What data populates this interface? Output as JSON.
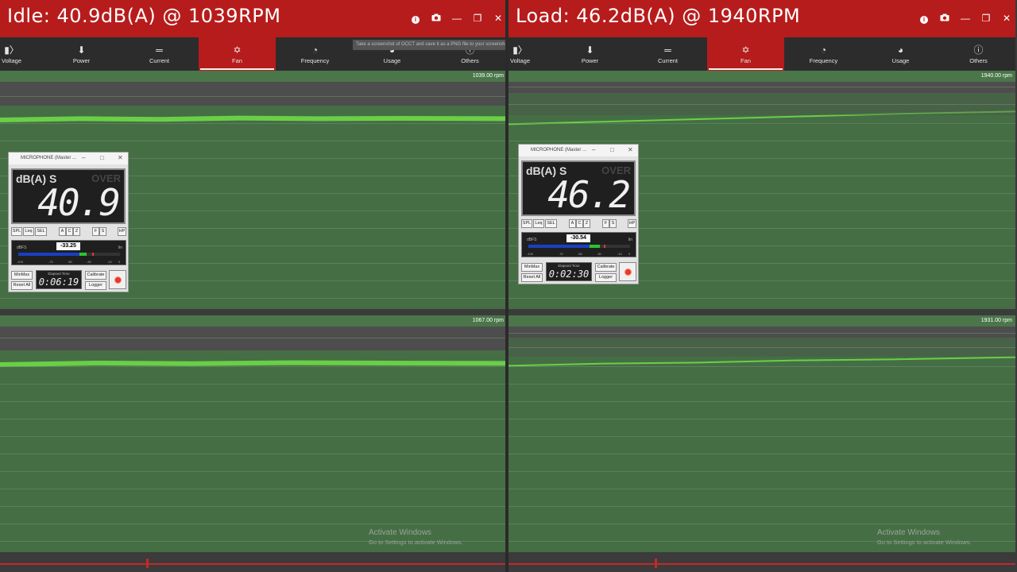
{
  "left": {
    "title": "Idle: 40.9dB(A) @ 1039RPM",
    "tabs": [
      "Voltage",
      "Power",
      "Current",
      "Fan",
      "Frequency",
      "Usage",
      "Others"
    ],
    "active_tab": "Fan",
    "tooltip": "Take a screenshot of OCCT and save it as a PNG file to your screenshot location",
    "panel_top_rpm": "1039.00 rpm",
    "panel_bottom_rpm": "1067.00 rpm",
    "meter": {
      "title": "MICROPHONE (Master ...",
      "unit": "dB(A) S",
      "over": "OVER",
      "reading": "40.9",
      "buttons": [
        "SPL",
        "Leq",
        "SEL",
        "A",
        "C",
        "Z",
        "F",
        "S",
        "HP"
      ],
      "dbfs_label": "dBFS",
      "lin_label": "lin",
      "dbfs_value": "-33.25",
      "scale": [
        "-100",
        "-70",
        "-50",
        "-30",
        "-10",
        "0"
      ],
      "minmax": "MinMax",
      "reset": "Reset All",
      "elapsed_label": "Elapsed Time",
      "elapsed": "0:06:19",
      "calibrate": "Calibrate",
      "logger": "Logger",
      "level_fraction": 0.67
    },
    "activate_title": "Activate Windows",
    "activate_sub": "Go to Settings to activate Windows."
  },
  "right": {
    "title": "Load: 46.2dB(A) @ 1940RPM",
    "tabs": [
      "Voltage",
      "Power",
      "Current",
      "Fan",
      "Frequency",
      "Usage",
      "Others"
    ],
    "active_tab": "Fan",
    "panel_top_rpm": "1940.00 rpm",
    "panel_bottom_rpm": "1931.00 rpm",
    "meter": {
      "title": "MICROPHONE (Master ...",
      "unit": "dB(A) S",
      "over": "OVER",
      "reading": "46.2",
      "buttons": [
        "SPL",
        "Leq",
        "SEL",
        "A",
        "C",
        "Z",
        "F",
        "S",
        "HP"
      ],
      "dbfs_label": "dBFS",
      "lin_label": "lin",
      "dbfs_value": "-30.54",
      "scale": [
        "-100",
        "-70",
        "-50",
        "-30",
        "-10",
        "0"
      ],
      "minmax": "MinMax",
      "reset": "Reset All",
      "elapsed_label": "Elapsed Time",
      "elapsed": "0:02:30",
      "calibrate": "Calibrate",
      "logger": "Logger",
      "level_fraction": 0.7
    },
    "activate_title": "Activate Windows",
    "activate_sub": "Go to Settings to activate Windows."
  },
  "colors": {
    "titlebar": "#b71c1c",
    "graph": "#456e45",
    "line": "#5fbf3f",
    "record": "#e53935"
  },
  "icons": [
    "info-icon",
    "camera-icon",
    "minimize-icon",
    "restore-icon",
    "close-icon",
    "voltage-icon",
    "power-plug-icon",
    "current-icon",
    "fan-icon",
    "gauge-icon",
    "usage-icon",
    "question-icon"
  ]
}
